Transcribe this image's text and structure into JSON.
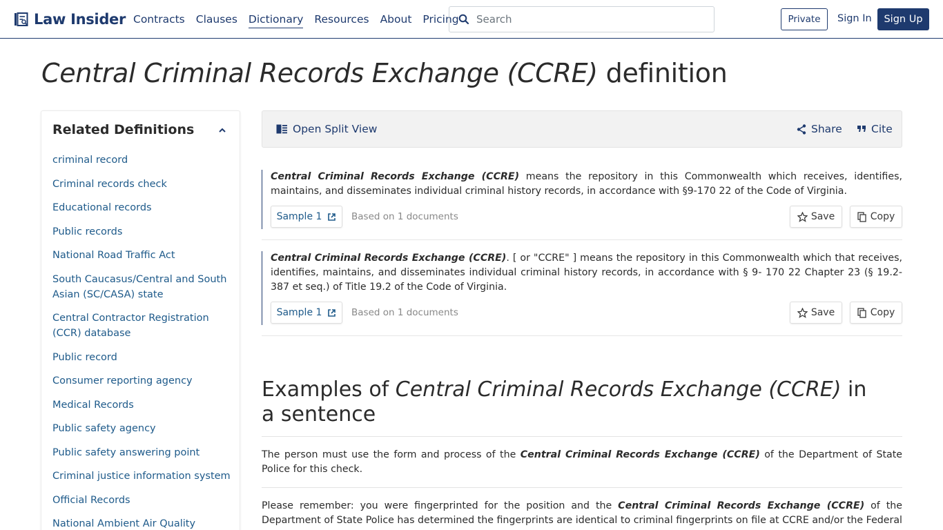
{
  "header": {
    "logo_text": "Law Insider",
    "nav": [
      "Contracts",
      "Clauses",
      "Dictionary",
      "Resources",
      "About",
      "Pricing"
    ],
    "active_nav": "Dictionary",
    "search_placeholder": "Search",
    "private_label": "Private",
    "signin_label": "Sign In",
    "signup_label": "Sign Up"
  },
  "title": {
    "term": "Central Criminal Records Exchange (CCRE)",
    "suffix": "definition"
  },
  "sidebar": {
    "heading": "Related Definitions",
    "items": [
      "criminal record",
      "Criminal records check",
      "Educational records",
      "Public records",
      "National Road Traffic Act",
      "South Caucasus/Central and South Asian (SC/CASA) state",
      "Central Contractor Registration (CCR) database",
      "Public record",
      "Consumer reporting agency",
      "Medical Records",
      "Public safety agency",
      "Public safety answering point",
      "Criminal justice information system",
      "Official Records",
      "National Ambient Air Quality"
    ]
  },
  "toolbar": {
    "split_label": "Open Split View",
    "share_label": "Share",
    "cite_label": "Cite"
  },
  "definitions": [
    {
      "term": "Central Criminal Records Exchange (CCRE)",
      "text": " means the repository in this Commonwealth which receives, identifies, maintains, and disseminates individual criminal history records, in accordance with §9-170 22 of the Code of Virginia.",
      "sample_label": "Sample 1",
      "based_on": "Based on 1 documents",
      "save_label": "Save",
      "copy_label": "Copy"
    },
    {
      "term": "Central Criminal Records Exchange (CCRE)",
      "text": ". [ or \"CCRE\" ] means the repository in this Commonwealth which that receives, identifies, maintains, and disseminates individual criminal history records, in accordance with § 9- 170 22 Chapter 23 (§ 19.2-387 et seq.) of Title 19.2 of the Code of Virginia.",
      "sample_label": "Sample 1",
      "based_on": "Based on 1 documents",
      "save_label": "Save",
      "copy_label": "Copy"
    }
  ],
  "examples": {
    "heading_prefix": "Examples of ",
    "heading_term": "Central Criminal Records Exchange (CCRE)",
    "heading_suffix": " in a sentence",
    "items": [
      {
        "before": "The person must use the form and process of the ",
        "term": "Central Criminal Records Exchange (CCRE)",
        "after": " of the Department of State Police for this check."
      },
      {
        "before": "Please remember: you were fingerprinted for the position and the ",
        "term": "Central Criminal Records Exchange (CCRE)",
        "after": " of the Department of State Police has determined the fingerprints are identical to criminal fingerprints on file at CCRE and/or the Federal Bureau of Investigation (FBI)"
      }
    ]
  },
  "colors": {
    "brand": "#1e3a6e",
    "link": "#1e5a8a",
    "toolbar_bg": "#f2f2f2"
  },
  "icons": [
    "logo-book-icon",
    "search-icon",
    "chevron-up-icon",
    "split-view-icon",
    "share-icon",
    "quote-icon",
    "external-link-icon",
    "star-icon",
    "copy-icon"
  ]
}
